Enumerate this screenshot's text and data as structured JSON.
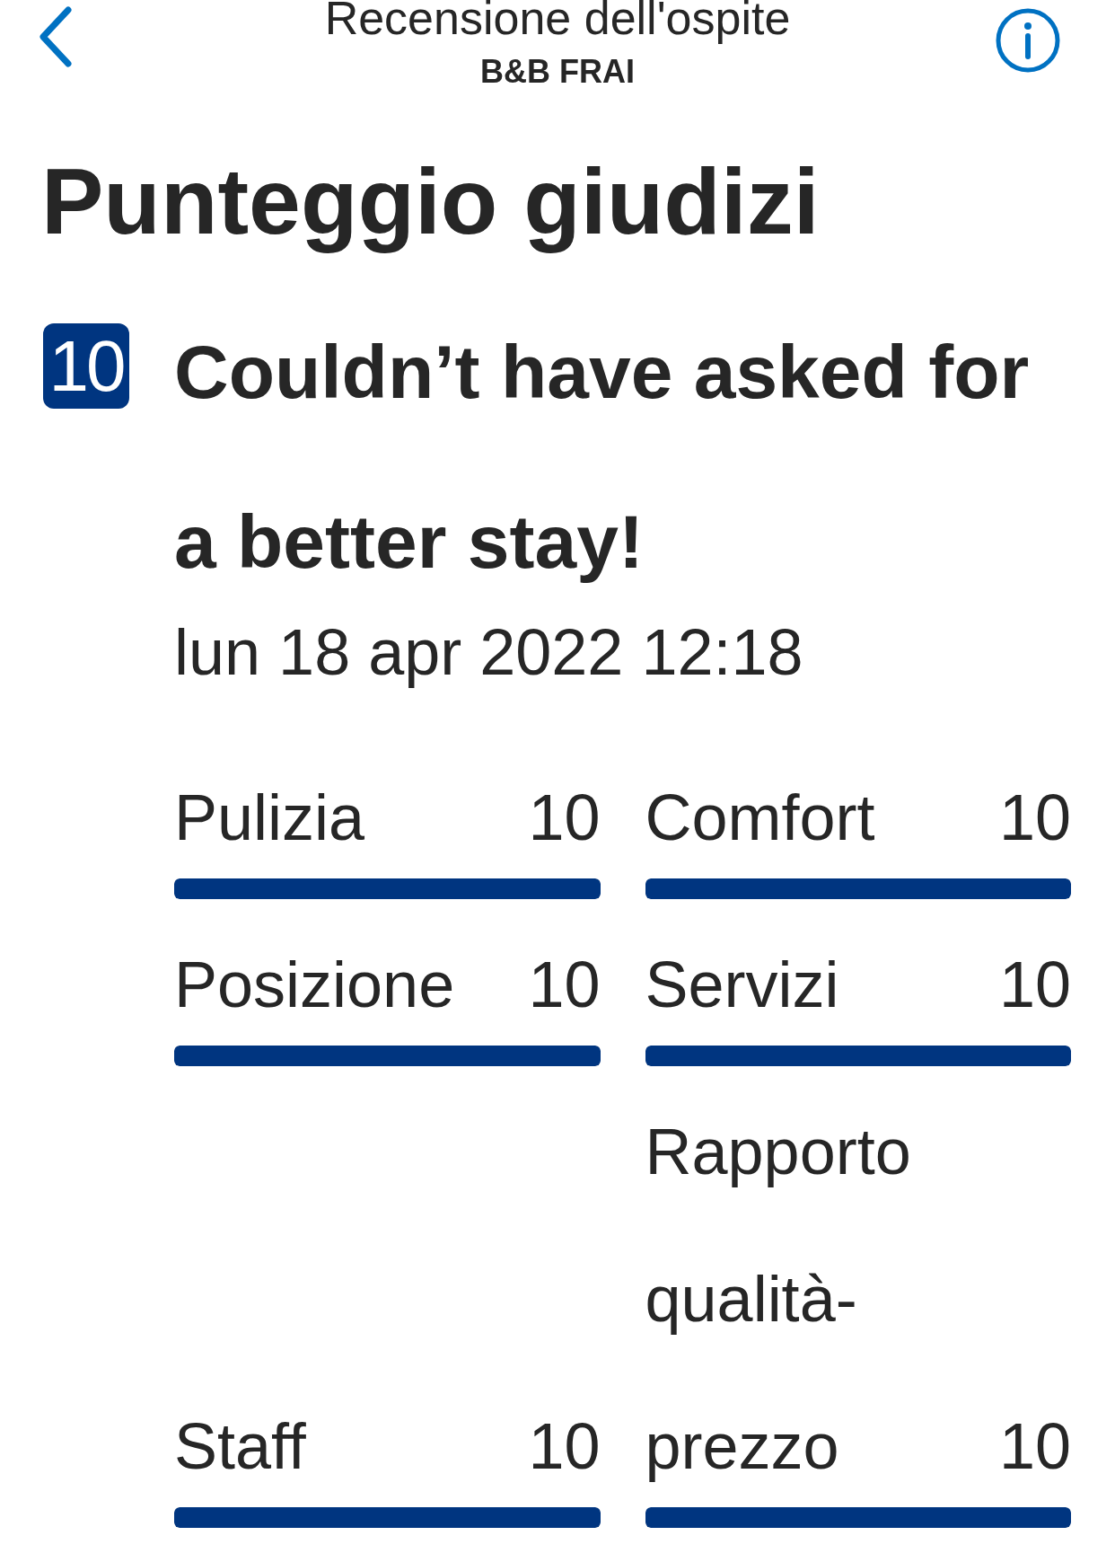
{
  "header": {
    "title": "Recensione dell'ospite",
    "subtitle": "B&B FRAI"
  },
  "section_title": "Punteggio giudizi",
  "review": {
    "score": "10",
    "headline": "Couldn’t have asked for a better stay!",
    "date": "lun 18 apr 2022 12:18"
  },
  "rating_rows": [
    {
      "cells": [
        {
          "label": "Pulizia",
          "score": "10",
          "level": 1
        },
        {
          "label": "Comfort",
          "score": "10",
          "level": 1
        }
      ]
    },
    {
      "cells": [
        {
          "label": "Posizione",
          "score": "10",
          "level": 1
        },
        {
          "label": "Servizi",
          "score": "10",
          "level": 1
        }
      ]
    },
    {
      "cells": [
        {
          "label": "Staff",
          "score": "10",
          "level": 1
        },
        {
          "label": "Rapporto qualità-prezzo",
          "score": "10",
          "level": 1
        }
      ]
    }
  ]
}
